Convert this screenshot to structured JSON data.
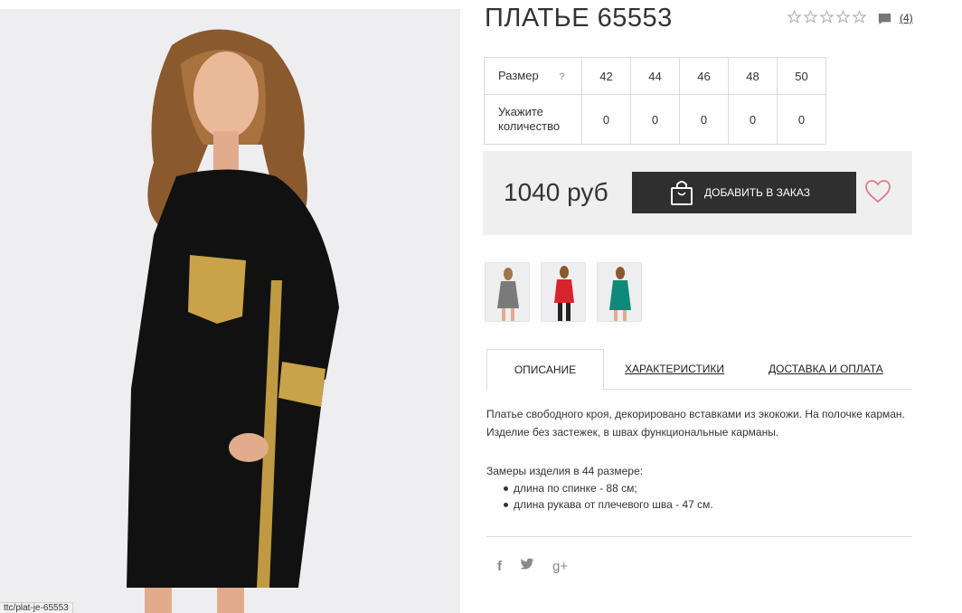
{
  "product": {
    "title": "ПЛАТЬЕ 65553",
    "rating_stars": 5,
    "rating_value": 0,
    "review_count": "(4)"
  },
  "size_table": {
    "size_label": "Размер",
    "help_icon": "?",
    "qty_label": "Укажите количество",
    "sizes": [
      "42",
      "44",
      "46",
      "48",
      "50"
    ],
    "quantities": [
      "0",
      "0",
      "0",
      "0",
      "0"
    ]
  },
  "buy": {
    "price": "1040 руб",
    "add_button": "ДОБАВИТЬ В ЗАКАЗ",
    "icons": [
      "shopping-bag-icon",
      "heart-icon"
    ]
  },
  "thumbnails": [
    {
      "color": "gray",
      "hex": "#7a7a7a"
    },
    {
      "color": "red",
      "hex": "#d8232a"
    },
    {
      "color": "green",
      "hex": "#0f8a7a"
    }
  ],
  "tabs": [
    "ОПИСАНИЕ",
    "ХАРАКТЕРИСТИКИ",
    "ДОСТАВКА И ОПЛАТА"
  ],
  "description": {
    "text": "Платье свободного кроя, декорировано вставками из экокожи. На полочке карман. Изделие без застежек, в швах функциональные карманы.",
    "measures_title": "Замеры изделия в 44 размере:",
    "measures": [
      "длина по спинке - 88 см;",
      "длина рукава от плечевого шва - 47 см."
    ]
  },
  "social": [
    "f",
    "t",
    "g+"
  ],
  "status_url": "ttc/plat-je-65553"
}
